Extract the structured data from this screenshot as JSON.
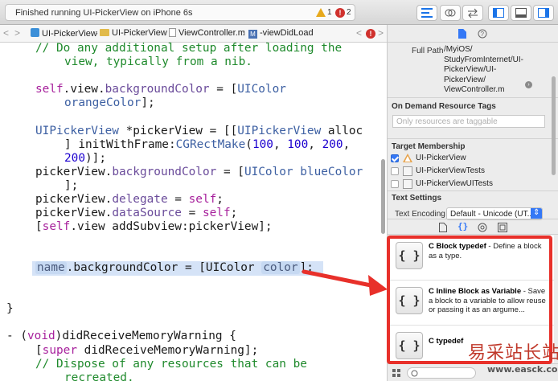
{
  "toolbar": {
    "activity_text": "Finished running UI-PickerView on iPhone 6s",
    "warning_count": "1",
    "error_count": "2"
  },
  "jumpbar": {
    "items": [
      "UI-PickerView",
      "UI-PickerView",
      "ViewController.m",
      "-viewDidLoad"
    ],
    "method_badge": "M",
    "file_badge": "m"
  },
  "code": {
    "line1": "// Do any additional setup after loading the",
    "line2": "view, typically from a nib.",
    "line3a": "self",
    "line3b": ".view.",
    "line3c": "backgroundColor",
    "line3d": " = [",
    "line3e": "UIColor",
    "line4": "orangeColor",
    "line4b": "];",
    "line5a": "UIPickerView",
    "line5b": " *pickerView = [[",
    "line5c": "UIPickerView",
    "line5d": " alloc",
    "line6a": "] initWithFrame:",
    "line6b": "CGRectMake",
    "line6c": "(",
    "line6n1": "100",
    "line6s1": ", ",
    "line6n2": "100",
    "line6s2": ", ",
    "line6n3": "200",
    "line6s3": ",",
    "line7n": "200",
    "line7b": ")];",
    "line8a": "pickerView.",
    "line8b": "backgroundColor",
    "line8c": " = [",
    "line8d": "UIColor",
    "line8e": " blueColor",
    "line9": "];",
    "line10a": "pickerView.",
    "line10b": "delegate",
    "line10c": " = ",
    "line10d": "self",
    "line10e": ";",
    "line11a": "pickerView.",
    "line11b": "dataSource",
    "line11c": " = ",
    "line11d": "self",
    "line11e": ";",
    "line12a": "[",
    "line12b": "self",
    "line12c": ".view addSubview:pickerView];",
    "line13ph1": "name",
    "line13b": ".backgroundColor = [UIColor ",
    "line13ph2": "color",
    "line13c": "];",
    "line14": "}",
    "line15a": "- (",
    "line15b": "void",
    "line15c": ")didReceiveMemoryWarning {",
    "line16a": "[",
    "line16b": "super",
    "line16c": " didReceiveMemoryWarning];",
    "line17": "// Dispose of any resources that can be",
    "line18": "recreated."
  },
  "inspector": {
    "full_path_label": "Full Path",
    "full_path_value": [
      "/MyiOS/",
      "StudyFromInternet/UI-",
      "PickerView/UI-",
      "PickerView/",
      "ViewController.m"
    ],
    "on_demand_title": "On Demand Resource Tags",
    "tags_placeholder": "Only resources are taggable",
    "target_membership_title": "Target Membership",
    "targets": [
      {
        "name": "UI-PickerView",
        "checked": true
      },
      {
        "name": "UI-PickerViewTests",
        "checked": false
      },
      {
        "name": "UI-PickerViewUITests",
        "checked": false
      }
    ],
    "text_settings_title": "Text Settings",
    "text_encoding_label": "Text Encoding",
    "text_encoding_value": "Default - Unicode (UT..."
  },
  "library": {
    "snippets": [
      {
        "title": "C Block typedef",
        "desc": " - Define a block as a type.",
        "icon": "{ }"
      },
      {
        "title": "C Inline Block as Variable",
        "desc": " - Save a block to a variable to allow reuse or passing it as an argume...",
        "icon": "{ }"
      },
      {
        "title": "C typedef",
        "desc": "",
        "icon": "{ }"
      }
    ]
  },
  "watermark": {
    "text": "易采站长站",
    "url": "www.easck.com"
  },
  "colors": {
    "keyword": "#a7219c",
    "class": "#3c5fa2",
    "comment": "#1f8a2c",
    "number": "#1c00cf",
    "annotation_red": "#e8302a",
    "accent_blue": "#3478f6"
  }
}
